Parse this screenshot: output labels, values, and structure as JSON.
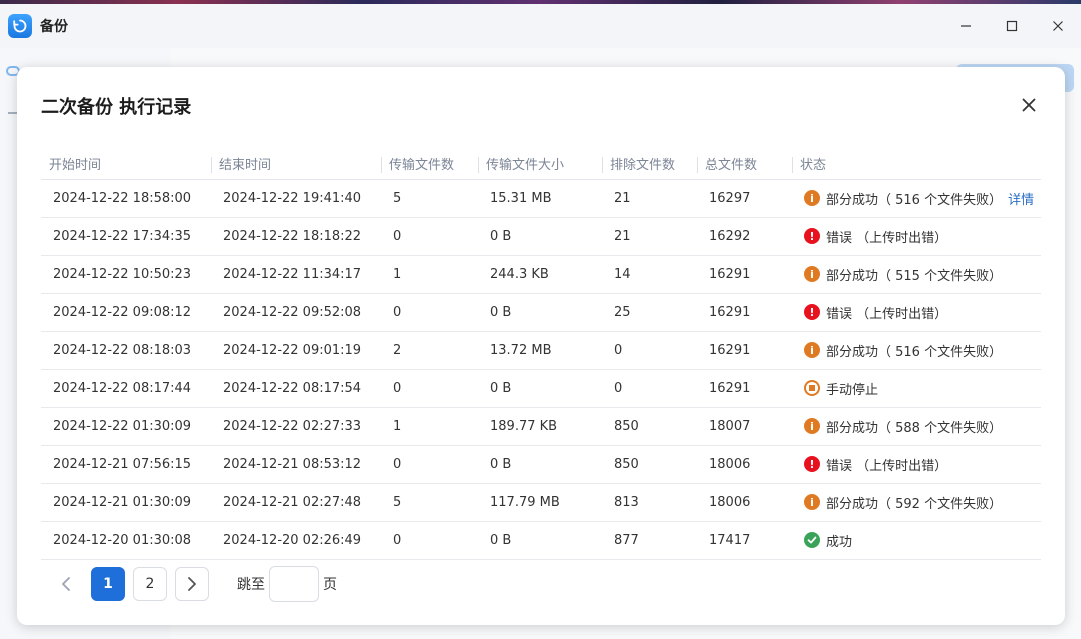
{
  "window": {
    "title": "备份",
    "colors": {
      "accent": "#1e6fd9",
      "partial": "#e07a22",
      "error": "#e8121f",
      "success": "#3aa35a"
    }
  },
  "dialog": {
    "title": "二次备份 执行记录",
    "columns": [
      "开始时间",
      "结束时间",
      "传输文件数",
      "传输文件大小",
      "排除文件数",
      "总文件数",
      "状态"
    ],
    "rows": [
      {
        "start": "2024-12-22 18:58:00",
        "end": "2024-12-22 19:41:40",
        "transferred": "5",
        "size": "15.31 MB",
        "excluded": "21",
        "total": "16297",
        "status_type": "partial",
        "status": "部分成功（ 516 个文件失败）",
        "detail": "详情"
      },
      {
        "start": "2024-12-22 17:34:35",
        "end": "2024-12-22 18:18:22",
        "transferred": "0",
        "size": "0 B",
        "excluded": "21",
        "total": "16292",
        "status_type": "error",
        "status": "错误 （上传时出错）"
      },
      {
        "start": "2024-12-22 10:50:23",
        "end": "2024-12-22 11:34:17",
        "transferred": "1",
        "size": "244.3 KB",
        "excluded": "14",
        "total": "16291",
        "status_type": "partial",
        "status": "部分成功（ 515 个文件失败）"
      },
      {
        "start": "2024-12-22 09:08:12",
        "end": "2024-12-22 09:52:08",
        "transferred": "0",
        "size": "0 B",
        "excluded": "25",
        "total": "16291",
        "status_type": "error",
        "status": "错误 （上传时出错）"
      },
      {
        "start": "2024-12-22 08:18:03",
        "end": "2024-12-22 09:01:19",
        "transferred": "2",
        "size": "13.72 MB",
        "excluded": "0",
        "total": "16291",
        "status_type": "partial",
        "status": "部分成功（ 516 个文件失败）"
      },
      {
        "start": "2024-12-22 08:17:44",
        "end": "2024-12-22 08:17:54",
        "transferred": "0",
        "size": "0 B",
        "excluded": "0",
        "total": "16291",
        "status_type": "stopped",
        "status": "手动停止"
      },
      {
        "start": "2024-12-22 01:30:09",
        "end": "2024-12-22 02:27:33",
        "transferred": "1",
        "size": "189.77 KB",
        "excluded": "850",
        "total": "18007",
        "status_type": "partial",
        "status": "部分成功（ 588 个文件失败）"
      },
      {
        "start": "2024-12-21 07:56:15",
        "end": "2024-12-21 08:53:12",
        "transferred": "0",
        "size": "0 B",
        "excluded": "850",
        "total": "18006",
        "status_type": "error",
        "status": "错误 （上传时出错）"
      },
      {
        "start": "2024-12-21 01:30:09",
        "end": "2024-12-21 02:27:48",
        "transferred": "5",
        "size": "117.79 MB",
        "excluded": "813",
        "total": "18006",
        "status_type": "partial",
        "status": "部分成功（ 592 个文件失败）"
      },
      {
        "start": "2024-12-20 01:30:08",
        "end": "2024-12-20 02:26:49",
        "transferred": "0",
        "size": "0 B",
        "excluded": "877",
        "total": "17417",
        "status_type": "success",
        "status": "成功"
      }
    ]
  },
  "pagination": {
    "pages": [
      "1",
      "2"
    ],
    "current": "1",
    "jump_label": "跳至",
    "jump_value": "",
    "jump_suffix": "页"
  }
}
